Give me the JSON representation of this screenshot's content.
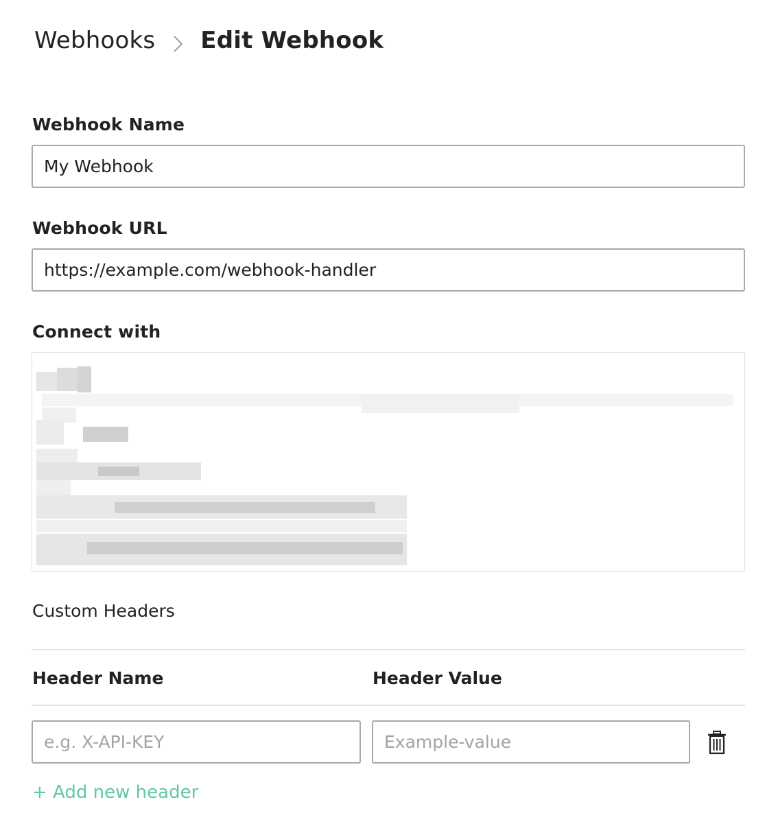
{
  "breadcrumb": {
    "parent": "Webhooks",
    "current": "Edit Webhook"
  },
  "form": {
    "name_label": "Webhook Name",
    "name_value": "My Webhook",
    "url_label": "Webhook URL",
    "url_value": "https://example.com/webhook-handler",
    "connect_label": "Connect with"
  },
  "custom_headers": {
    "title": "Custom Headers",
    "col_name": "Header Name",
    "col_value": "Header Value",
    "row": {
      "name_placeholder": "e.g. X-API-KEY",
      "value_placeholder": "Example-value"
    },
    "add_label": "+ Add new header"
  },
  "icons": {
    "breadcrumb_separator": "chevron-right-icon",
    "delete_row": "trash-icon"
  },
  "colors": {
    "accent": "#5fc8a4",
    "input_border": "#a9a9a9",
    "divider": "#e4e4e4"
  }
}
